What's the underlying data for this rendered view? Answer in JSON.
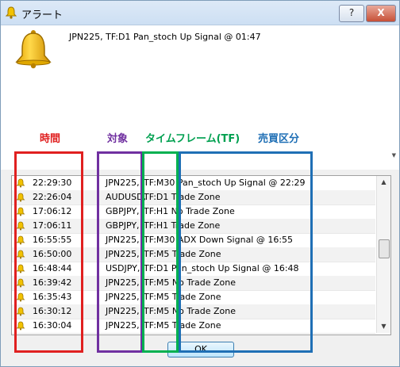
{
  "window": {
    "title": "アラート",
    "help_label": "?",
    "close_label": "X"
  },
  "message": {
    "text": "JPN225, TF:D1 Pan_stoch Up Signal @ 01:47"
  },
  "annotations": {
    "time": "時間",
    "target": "対象",
    "timeframe": "タイムフレーム(TF)",
    "category": "売買区分"
  },
  "alerts": [
    {
      "time": "22:29:30",
      "symbol": "JPN225,",
      "message": "TF:M30 Pan_stoch Up Signal @ 22:29"
    },
    {
      "time": "22:26:04",
      "symbol": "AUDUSD,",
      "message": "TF:D1 Trade Zone"
    },
    {
      "time": "17:06:12",
      "symbol": "GBPJPY,",
      "message": "TF:H1 No Trade Zone"
    },
    {
      "time": "17:06:11",
      "symbol": "GBPJPY,",
      "message": "TF:H1 Trade Zone"
    },
    {
      "time": "16:55:55",
      "symbol": "JPN225,",
      "message": "TF:M30 ADX Down Signal @ 16:55"
    },
    {
      "time": "16:50:00",
      "symbol": "JPN225,",
      "message": "TF:M5 Trade Zone"
    },
    {
      "time": "16:48:44",
      "symbol": "USDJPY,",
      "message": "TF:D1 Pan_stoch Up Signal @ 16:48"
    },
    {
      "time": "16:39:42",
      "symbol": "JPN225,",
      "message": "TF:M5 No Trade Zone"
    },
    {
      "time": "16:35:43",
      "symbol": "JPN225,",
      "message": "TF:M5 Trade Zone"
    },
    {
      "time": "16:30:12",
      "symbol": "JPN225,",
      "message": "TF:M5 No Trade Zone"
    },
    {
      "time": "16:30:04",
      "symbol": "JPN225,",
      "message": "TF:M5 Trade Zone"
    }
  ],
  "ok_label": "OK",
  "colors": {
    "time": "#e02020",
    "target": "#7030a0",
    "timeframe": "#00b050",
    "category": "#1f6fb5",
    "bell": "#f0b400"
  },
  "icons": {
    "bell": "bell-icon"
  }
}
